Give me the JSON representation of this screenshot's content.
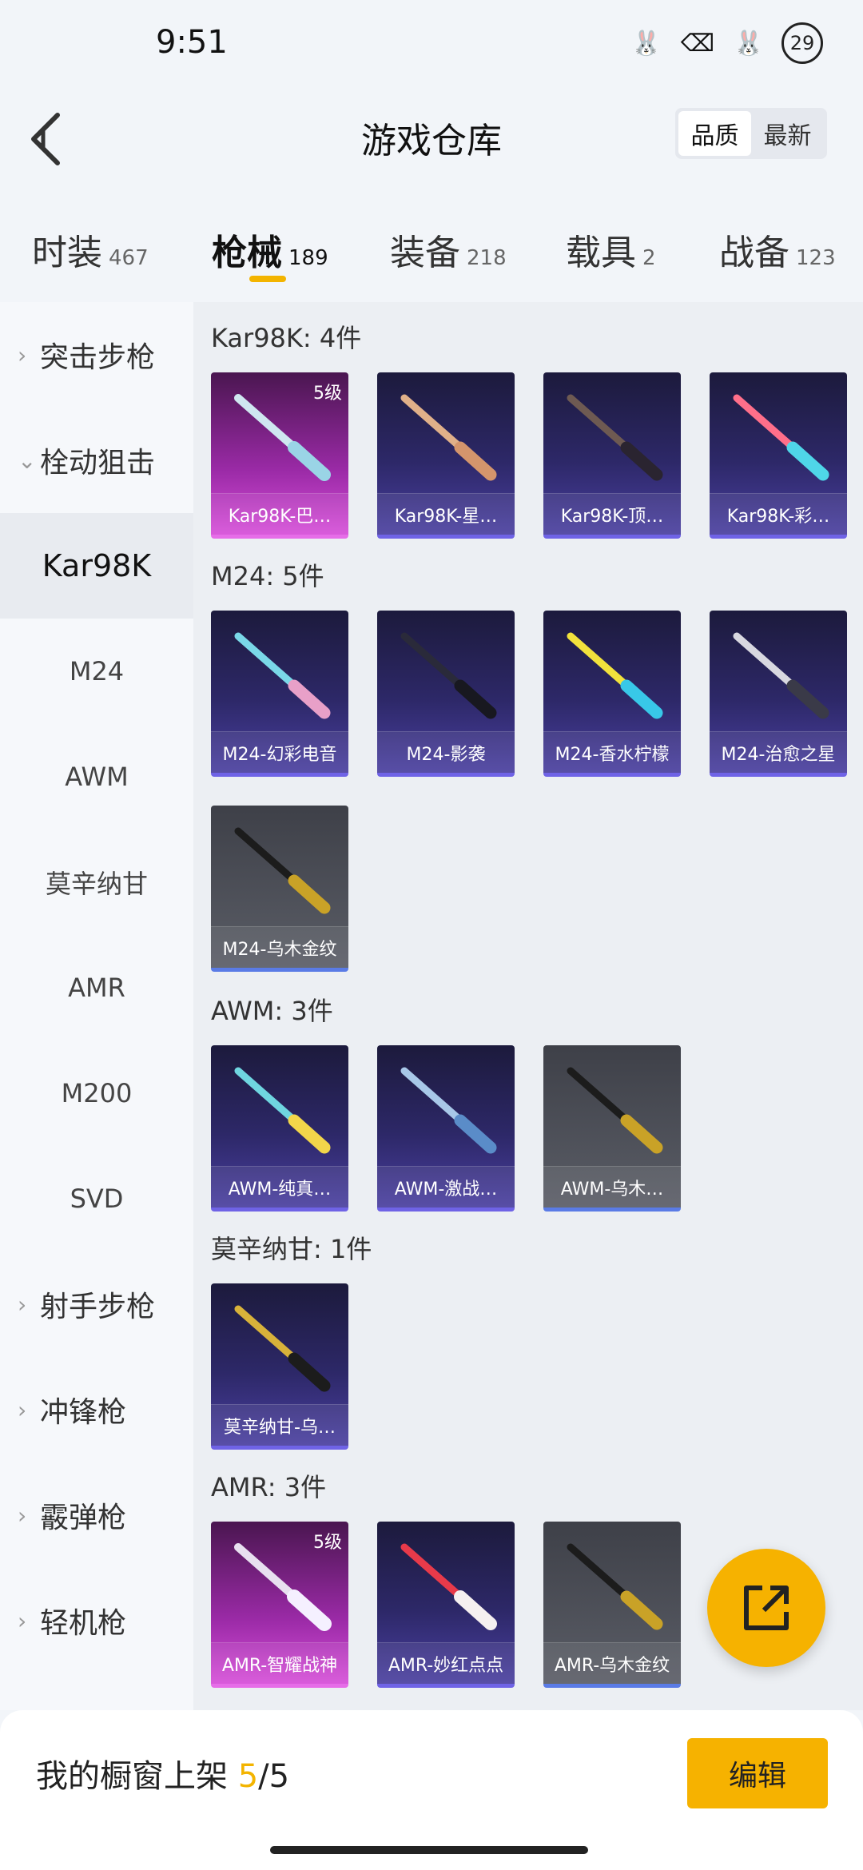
{
  "status": {
    "time": "9:51",
    "badge": "29"
  },
  "header": {
    "title": "游戏仓库",
    "sort": {
      "quality": "品质",
      "latest": "最新"
    }
  },
  "tabs": [
    {
      "label": "时装",
      "count": "467"
    },
    {
      "label": "枪械",
      "count": "189"
    },
    {
      "label": "装备",
      "count": "218"
    },
    {
      "label": "载具",
      "count": "2"
    },
    {
      "label": "战备",
      "count": "123"
    }
  ],
  "sidebar": {
    "groups": [
      "突击步枪",
      "栓动狙击",
      "射手步枪",
      "冲锋枪",
      "霰弹枪",
      "轻机枪"
    ],
    "subs": [
      "Kar98K",
      "M24",
      "AWM",
      "莫辛纳甘",
      "AMR",
      "M200",
      "SVD"
    ]
  },
  "sections": [
    {
      "title": "Kar98K: 4件",
      "items": [
        {
          "name": "Kar98K-巴…",
          "rarity": "purple",
          "level": "5级"
        },
        {
          "name": "Kar98K-星…",
          "rarity": "blue"
        },
        {
          "name": "Kar98K-顶…",
          "rarity": "blue"
        },
        {
          "name": "Kar98K-彩…",
          "rarity": "blue"
        }
      ]
    },
    {
      "title": "M24: 5件",
      "items": [
        {
          "name": "M24-幻彩电音",
          "rarity": "blue"
        },
        {
          "name": "M24-影袭",
          "rarity": "blue"
        },
        {
          "name": "M24-香水柠檬",
          "rarity": "blue"
        },
        {
          "name": "M24-治愈之星",
          "rarity": "blue"
        },
        {
          "name": "M24-乌木金纹",
          "rarity": "gray"
        }
      ]
    },
    {
      "title": "AWM: 3件",
      "items": [
        {
          "name": "AWM-纯真…",
          "rarity": "blue"
        },
        {
          "name": "AWM-激战…",
          "rarity": "blue"
        },
        {
          "name": "AWM-乌木…",
          "rarity": "gray"
        }
      ]
    },
    {
      "title": "莫辛纳甘: 1件",
      "items": [
        {
          "name": "莫辛纳甘-乌…",
          "rarity": "blue"
        }
      ]
    },
    {
      "title": "AMR: 3件",
      "items": [
        {
          "name": "AMR-智耀战神",
          "rarity": "purple",
          "level": "5级"
        },
        {
          "name": "AMR-妙红点点",
          "rarity": "blue"
        },
        {
          "name": "AMR-乌木金纹",
          "rarity": "gray"
        }
      ]
    }
  ],
  "footer": {
    "label": "我的橱窗上架",
    "current": "5",
    "total": "/5",
    "edit": "编辑"
  },
  "colors": {
    "accent": "#f6b200",
    "blue_card": "#2d2868",
    "purple_card": "#9a2aa6",
    "gray_card": "#5a5d66"
  }
}
